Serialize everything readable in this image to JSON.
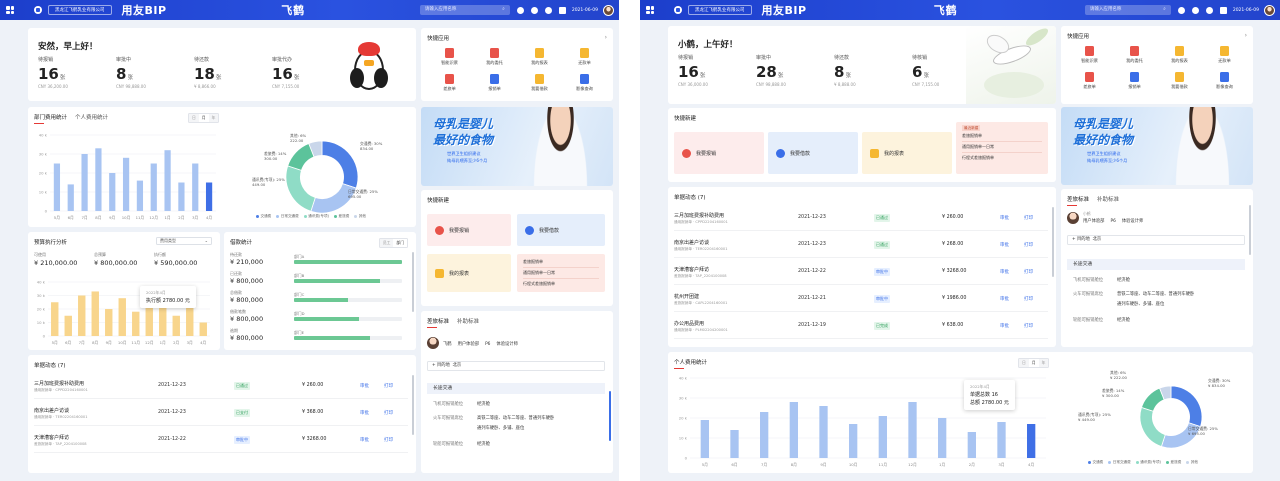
{
  "app": {
    "org_name": "黑龙江飞鹤乳业有限公司",
    "brand": "用友BIP",
    "logo_text": "飞鹤",
    "search_placeholder": "请输入应用名称",
    "date": "2021-06-09",
    "colors": {
      "topbar": "#2247d6",
      "accent_red": "#e53935",
      "bar_blue": "#a8c4f2",
      "bar_selected": "#3f6fe6",
      "bar_yellow": "#f8d58c",
      "bar_green": "#6cc894"
    }
  },
  "icons": [
    "app-grid-icon",
    "home-icon",
    "search-icon",
    "bell-icon",
    "message-icon",
    "chat-icon",
    "calendar-icon",
    "avatar"
  ],
  "left": {
    "greeting": "安然，早上好！",
    "stats": [
      {
        "label": "待报销",
        "value": "16",
        "unit": "张",
        "sub": "CNY 36,200.00"
      },
      {
        "label": "审批中",
        "value": "8",
        "unit": "张",
        "sub": "CNY 98,888.00"
      },
      {
        "label": "待还款",
        "value": "18",
        "unit": "张",
        "sub": "¥ 8,866.00"
      },
      {
        "label": "审批代办",
        "value": "16",
        "unit": "张",
        "sub": "CNY 7,155.00"
      }
    ],
    "quick_apps": {
      "title": "快捷应用",
      "items": [
        {
          "label": "智能识票",
          "color": "#e8534a"
        },
        {
          "label": "我的委托",
          "color": "#e8534a"
        },
        {
          "label": "我的报表",
          "color": "#f5b731"
        },
        {
          "label": "还款单",
          "color": "#f5b731"
        },
        {
          "label": "差旅单",
          "color": "#e8534a"
        },
        {
          "label": "报销单",
          "color": "#3a6ee8"
        },
        {
          "label": "我要借款",
          "color": "#f5b731"
        },
        {
          "label": "影像查询",
          "color": "#3a6ee8"
        }
      ]
    },
    "banner": {
      "line1": "母乳是婴儿",
      "line2": "最好的食物",
      "sub1": "世界卫生组织建议",
      "sub2": "纯母乳喂养至少6个月"
    },
    "dept_expense": {
      "tabs": [
        "部门费用统计",
        "个人费用统计"
      ],
      "toggle": [
        "日",
        "月",
        "年"
      ],
      "chart_data": {
        "type": "bar",
        "categories": [
          "5月",
          "6月",
          "7月",
          "8月",
          "9月",
          "10月",
          "11月",
          "12月",
          "1月",
          "2月",
          "3月",
          "4月"
        ],
        "values": [
          25,
          14,
          30,
          33,
          20,
          28,
          16,
          25,
          32,
          15,
          25,
          15
        ],
        "ylim": [
          0,
          40
        ],
        "yticks": [
          "0",
          "10 k",
          "20 k",
          "30 k",
          "40 k"
        ],
        "selected_index": 11
      },
      "pie": {
        "chart_data": {
          "type": "pie",
          "slices": [
            {
              "name": "交通费",
              "pct": 30,
              "amount": "¥ 834.00",
              "color": "#4d7fe6"
            },
            {
              "name": "日常交通费",
              "pct": 25,
              "amount": "¥ 695.00",
              "color": "#a8c4f2"
            },
            {
              "name": "通讯费(专项)",
              "pct": 25,
              "amount": "¥ 449.00",
              "color": "#8fdcc6"
            },
            {
              "name": "差旅费",
              "pct": 14,
              "amount": "¥ 300.00",
              "color": "#5cc39b"
            },
            {
              "name": "其他",
              "pct": 6,
              "amount": "¥ 222.00",
              "color": "#c9d6ea"
            }
          ]
        },
        "labels": [
          {
            "name": "其他: 6%",
            "amount": "222.00"
          },
          {
            "name": "交通费: 30%",
            "amount": "834.00"
          },
          {
            "name": "差旅费: 14%",
            "amount": "300.00"
          },
          {
            "name": "通讯费(专项): 25%",
            "amount": "449.00"
          },
          {
            "name": "日常交通费: 25%",
            "amount": "695.00"
          }
        ],
        "legend": [
          "交通费",
          "日常交通费",
          "通讯费(专项)",
          "差旅费",
          "其他"
        ]
      }
    },
    "quick_new": {
      "title": "快捷新建",
      "items": [
        {
          "label": "我要报销",
          "bg": "#fdecec",
          "ic": "#e8534a"
        },
        {
          "label": "我要借款",
          "bg": "#e5eefb",
          "ic": "#3a6ee8"
        },
        {
          "label": "我的报表",
          "bg": "#fdf3dd",
          "ic": "#f5b731"
        }
      ],
      "recent_label": "最近新建",
      "recent": [
        "差旅报销单",
        "通用报销单—日常",
        "行程式差旅报销单"
      ]
    },
    "budget": {
      "title": "预算执行分析",
      "select": "费用类型",
      "summary": [
        {
          "label": "可使用",
          "value": "¥ 210,000.00"
        },
        {
          "label": "总预算",
          "value": "¥ 800,000.00"
        },
        {
          "label": "执行额",
          "value": "¥ 590,000.00"
        }
      ],
      "chart_data": {
        "type": "bar",
        "categories": [
          "5月",
          "6月",
          "7月",
          "8月",
          "9月",
          "10月",
          "11月",
          "12月",
          "1月",
          "2月",
          "3月",
          "4月"
        ],
        "values": [
          25,
          15,
          30,
          33,
          20,
          28,
          18,
          25,
          30,
          15,
          22,
          10
        ],
        "ylim": [
          0,
          40
        ],
        "yticks": [
          "0",
          "10 k",
          "20 k",
          "30 k",
          "40 k"
        ]
      },
      "tooltip": {
        "t1": "2022年4月",
        "t2": "执行额 2780.00 元"
      }
    },
    "budget_stats": {
      "title": "借款统计",
      "toggle": [
        "员工",
        "部门"
      ],
      "items": [
        {
          "label": "待还款",
          "value": "¥ 210,000",
          "dept": "部门A",
          "pct": 100
        },
        {
          "label": "已还款",
          "value": "¥ 800,000",
          "dept": "部门B",
          "pct": 80
        },
        {
          "label": "总借款",
          "value": "¥ 800,000",
          "dept": "部门C",
          "pct": 50
        },
        {
          "label": "借款笔数",
          "value": "¥ 800,000",
          "dept": "部门D",
          "pct": 60
        },
        {
          "label": "逾期",
          "value": "¥ 800,000",
          "dept": "部门E",
          "pct": 70
        }
      ]
    },
    "docs": {
      "title": "单据动态 (7)",
      "rows": [
        {
          "name": "三月加班费报补助费用",
          "no": "通用报销单 · CPPD2204160001",
          "date": "2021-12-23",
          "status": "已通过",
          "st": "ok",
          "amount": "¥ 260.00"
        },
        {
          "name": "南京出差户访谈",
          "no": "通用报销单 · TER02204160001",
          "date": "2021-12-23",
          "status": "已支付",
          "st": "ok",
          "amount": "¥ 368.00"
        },
        {
          "name": "天津漕客户拜访",
          "no": "差旅报销单 · TAP_2204100008",
          "date": "2021-12-22",
          "status": "审批中",
          "st": "wait",
          "amount": "¥ 3268.00"
        }
      ],
      "act1": "审批",
      "act2": "打印"
    },
    "travel": {
      "tabs": [
        "差旅标准",
        "补助标准"
      ],
      "person_name": "飞鹤",
      "person_meta": [
        "用户体验部",
        "P6",
        "体验设计师"
      ],
      "city": "北京",
      "city_prefix": "+ 目的地",
      "section": "长途交通",
      "rows": [
        {
          "k": "飞机可报销舱位",
          "v": "经济舱"
        },
        {
          "k": "火车可报销席位",
          "v": "高铁二等座、动车二等座、普通列车硬卧"
        },
        {
          "k": "",
          "v": "通列车硬卧、多铺、座位"
        },
        {
          "k": "轮船可报销舱位",
          "v": "经济舱"
        }
      ]
    }
  },
  "right": {
    "greeting": "小鹤，上午好！",
    "stats": [
      {
        "label": "待报销",
        "value": "16",
        "unit": "张",
        "sub": "CNY 36,000.00"
      },
      {
        "label": "审批中",
        "value": "28",
        "unit": "张",
        "sub": "CNY 98,888.00"
      },
      {
        "label": "待还款",
        "value": "8",
        "unit": "张",
        "sub": "¥ 8,888.00"
      },
      {
        "label": "待核销",
        "value": "6",
        "unit": "张",
        "sub": "CNY 7,155.00"
      }
    ],
    "quick_apps": {
      "title": "快捷应用",
      "items": [
        {
          "label": "智能识票",
          "color": "#e8534a"
        },
        {
          "label": "我的委托",
          "color": "#e8534a"
        },
        {
          "label": "我的报表",
          "color": "#f5b731"
        },
        {
          "label": "还款单",
          "color": "#f5b731"
        },
        {
          "label": "差旅单",
          "color": "#e8534a"
        },
        {
          "label": "报销单",
          "color": "#3a6ee8"
        },
        {
          "label": "我要借款",
          "color": "#f5b731"
        },
        {
          "label": "影像查询",
          "color": "#3a6ee8"
        }
      ]
    },
    "quick_new": {
      "title": "快捷新建",
      "items": [
        {
          "label": "我要报销",
          "bg": "#fdecec",
          "ic": "#e8534a"
        },
        {
          "label": "我要借款",
          "bg": "#e5eefb",
          "ic": "#3a6ee8"
        },
        {
          "label": "我的报表",
          "bg": "#fdf3dd",
          "ic": "#f5b731"
        }
      ],
      "recent_label": "最近新建",
      "recent": [
        "差旅报销单",
        "通用报销单—日常",
        "行程式差旅报销单"
      ]
    },
    "banner": {
      "line1": "母乳是婴儿",
      "line2": "最好的食物",
      "sub1": "世界卫生组织建议",
      "sub2": "纯母乳喂养至少6个月"
    },
    "docs": {
      "title": "单据动态 (7)",
      "rows": [
        {
          "name": "三月加班费报补助费用",
          "no": "通用报销单 · CPPD2204160001",
          "date": "2021-12-23",
          "status": "已通过",
          "st": "ok",
          "amount": "¥ 260.00"
        },
        {
          "name": "南京出差户访谈",
          "no": "通用报销单 · TER02204160001",
          "date": "2021-12-23",
          "status": "已通过",
          "st": "ok",
          "amount": "¥ 268.00"
        },
        {
          "name": "天津漕客户拜访",
          "no": "差旅报销单 · TAP_2204100008",
          "date": "2021-12-22",
          "status": "审批中",
          "st": "wait",
          "amount": "¥ 3268.00"
        },
        {
          "name": "杭州开团建",
          "no": "差旅报销单 · CAPL2204160001",
          "date": "2021-12-21",
          "status": "审批中",
          "st": "wait",
          "amount": "¥ 1986.00"
        },
        {
          "name": "办公用品费用",
          "no": "通用报销单 · PLM02204200001",
          "date": "2021-12-19",
          "status": "已完成",
          "st": "ok",
          "amount": "¥ 638.00"
        }
      ],
      "act1": "审批",
      "act2": "打印"
    },
    "travel": {
      "tabs": [
        "差旅标准",
        "补助标准"
      ],
      "person_name": "小鹤",
      "person_meta": [
        "用户体验部",
        "P6",
        "体验设计师"
      ],
      "city": "北京",
      "city_prefix": "+ 目的地",
      "section": "长途交通",
      "rows": [
        {
          "k": "飞机可报销舱位",
          "v": "经济舱"
        },
        {
          "k": "火车可报销席位",
          "v": "普铁二等座、动车二等座、普通列车硬卧"
        },
        {
          "k": "",
          "v": "通列车硬卧、多铺、座位"
        },
        {
          "k": "轮船可报销舱位",
          "v": "经济舱"
        }
      ]
    },
    "personal_expense": {
      "title": "个人费用统计",
      "toggle": [
        "日",
        "月",
        "年"
      ],
      "chart_data": {
        "type": "bar",
        "categories": [
          "5月",
          "6月",
          "7月",
          "8月",
          "9月",
          "10月",
          "11月",
          "12月",
          "1月",
          "2月",
          "3月",
          "4月"
        ],
        "values": [
          19,
          14,
          23,
          28,
          26,
          17,
          21,
          28,
          20,
          13,
          18,
          17
        ],
        "ylim": [
          0,
          40
        ],
        "yticks": [
          "0",
          "10 k",
          "20 k",
          "30 k",
          "40 k"
        ],
        "selected_index": 11
      },
      "tooltip": {
        "t1": "2022年4月",
        "t2": "单据总数 16",
        "t3": "总额 2780.00 元"
      },
      "pie_labels": [
        {
          "name": "其他: 6%",
          "amount": "¥ 222.00"
        },
        {
          "name": "交通费: 30%",
          "amount": "¥ 834.00"
        },
        {
          "name": "差旅费: 14%",
          "amount": "¥ 300.00"
        },
        {
          "name": "通讯费(专项): 25%",
          "amount": "¥ 449.00"
        },
        {
          "name": "日常交通费: 25%",
          "amount": "¥ 695.00"
        }
      ],
      "legend": [
        "交通费",
        "日常交通费",
        "通讯费(专项)",
        "差旅费",
        "其他"
      ]
    }
  }
}
